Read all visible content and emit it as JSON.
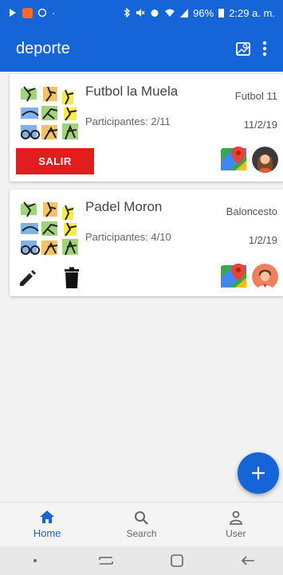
{
  "status_bar": {
    "battery": "96%",
    "time": "2:29 a. m."
  },
  "app": {
    "title": "deporte",
    "colors": {
      "primary": "#1565d8",
      "danger": "#e01e1e"
    }
  },
  "events": [
    {
      "title": "Futbol la Muela",
      "participants": "Participantes: 2/11",
      "sport": "Futbol 11",
      "date": "11/2/19",
      "action_label": "SALIR"
    },
    {
      "title": "Padel Moron",
      "participants": "Participantes: 4/10",
      "sport": "Baloncesto",
      "date": "1/2/19"
    }
  ],
  "bottom_nav": [
    {
      "label": "Home",
      "icon": "home-icon",
      "active": true
    },
    {
      "label": "Search",
      "icon": "search-icon",
      "active": false
    },
    {
      "label": "User",
      "icon": "user-icon",
      "active": false
    }
  ],
  "fab": {
    "icon": "plus-icon"
  }
}
